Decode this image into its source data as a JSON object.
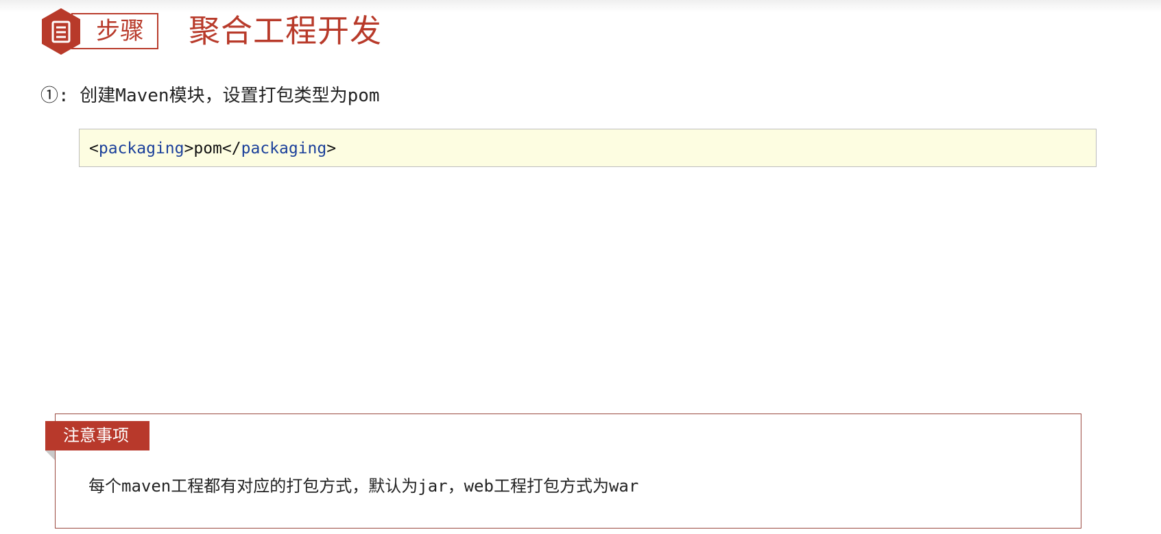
{
  "header": {
    "badge_icon": "document-icon",
    "badge_label": "步骤",
    "title": "聚合工程开发"
  },
  "step": {
    "text": "①: 创建Maven模块，设置打包类型为pom"
  },
  "code": {
    "open_lt": "<",
    "open_tag": "packaging",
    "open_gt": ">",
    "value": "pom",
    "close_lt": "</",
    "close_tag": "packaging",
    "close_gt": ">"
  },
  "note": {
    "tab_label": "注意事项",
    "text": "每个maven工程都有对应的打包方式，默认为jar，web工程打包方式为war"
  },
  "colors": {
    "accent": "#b83a2a",
    "code_background": "#fdfde1",
    "code_tag": "#1a3f9a"
  }
}
